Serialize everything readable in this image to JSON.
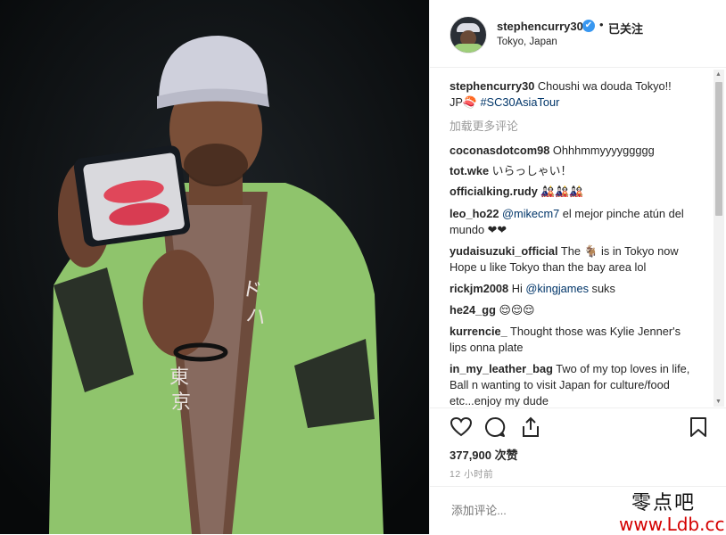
{
  "post": {
    "username": "stephencurry30",
    "verified_badge": "✔",
    "separator": "•",
    "follow_label": "已关注",
    "location": "Tokyo, Japan"
  },
  "caption": {
    "username": "stephencurry30",
    "text": " Choushi wa douda Tokyo!!",
    "prefix": "JP🍣 ",
    "hashtag": "#SC30AsiaTour"
  },
  "load_more": "加载更多评论",
  "comments": [
    {
      "user": "coconasdotcom98",
      "text": " Ohhhmmyyyyggggg"
    },
    {
      "user": "tot.wke",
      "text": " いらっしゃい！"
    },
    {
      "user": "officialking.rudy",
      "text": " 🎎🎎🎎"
    },
    {
      "user": "leo_ho22",
      "mention": " @mikecm7",
      "text": " el mejor pinche atún del mundo ❤❤"
    },
    {
      "user": "yudaisuzuki_official",
      "text": " The 🐐 is in Tokyo now Hope u like Tokyo than the bay area lol"
    },
    {
      "user": "rickjm2008",
      "text": " Hi ",
      "mention": "@kingjames",
      "text2": " suks"
    },
    {
      "user": "he24_gg",
      "text": " 😌😌😌"
    },
    {
      "user": "kurrencie_",
      "text": " Thought those was Kylie Jenner's lips onna plate"
    },
    {
      "user": "in_my_leather_bag",
      "text": " Two of my top loves in life, Ball n wanting to visit Japan for culture/food etc...enjoy my dude"
    }
  ],
  "actions": {
    "like_icon": "heart-icon",
    "comment_icon": "comment-icon",
    "share_icon": "share-icon",
    "save_icon": "bookmark-icon"
  },
  "likes": "377,900 次赞",
  "time": "12 小时前",
  "add_comment_placeholder": "添加评论...",
  "watermark": {
    "line1": "零点吧",
    "line2": "www.Ldb.cc"
  }
}
